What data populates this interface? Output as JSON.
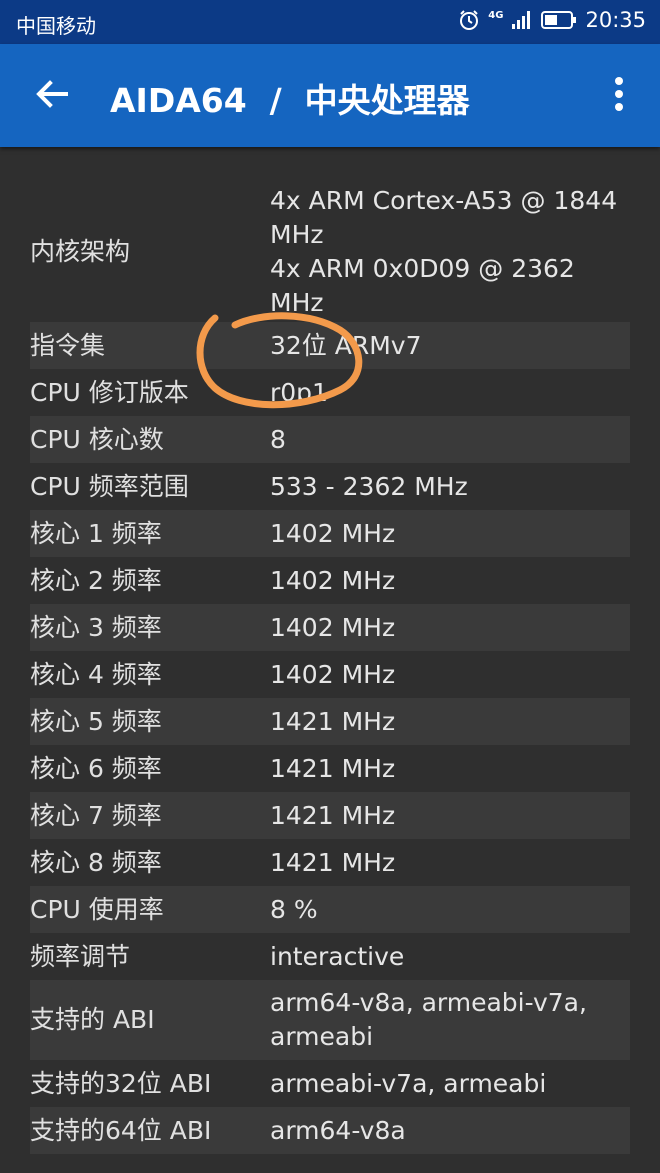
{
  "status": {
    "carrier": "中国移动",
    "network": "4G",
    "time": "20:35"
  },
  "appbar": {
    "title": "AIDA64  /  中央处理器"
  },
  "rows": [
    {
      "label": "内核架构",
      "value": "4x ARM Cortex-A53 @ 1844 MHz\n4x ARM 0x0D09 @ 2362 MHz"
    },
    {
      "label": "指令集",
      "value": "32位 ARMv7"
    },
    {
      "label": "CPU 修订版本",
      "value": "r0p1"
    },
    {
      "label": "CPU 核心数",
      "value": "8"
    },
    {
      "label": "CPU 频率范围",
      "value": "533 - 2362 MHz"
    },
    {
      "label": "核心 1 频率",
      "value": "1402 MHz"
    },
    {
      "label": "核心 2 频率",
      "value": "1402 MHz"
    },
    {
      "label": "核心 3 频率",
      "value": "1402 MHz"
    },
    {
      "label": "核心 4 频率",
      "value": "1402 MHz"
    },
    {
      "label": "核心 5 频率",
      "value": "1421 MHz"
    },
    {
      "label": "核心 6 频率",
      "value": "1421 MHz"
    },
    {
      "label": "核心 7 频率",
      "value": "1421 MHz"
    },
    {
      "label": "核心 8 频率",
      "value": "1421 MHz"
    },
    {
      "label": "CPU 使用率",
      "value": "8 %"
    },
    {
      "label": "频率调节",
      "value": "interactive"
    },
    {
      "label": "支持的 ABI",
      "value": "arm64-v8a, armeabi-v7a, armeabi"
    },
    {
      "label": "支持的32位 ABI",
      "value": "armeabi-v7a, armeabi"
    },
    {
      "label": "支持的64位 ABI",
      "value": "arm64-v8a"
    }
  ],
  "colors": {
    "appbar": "#1565c0",
    "statusbar": "#0c3a86",
    "background": "#2f2f2f",
    "row_alt": "#3a3a3a",
    "annotation": "#f39a4b"
  },
  "icons": {
    "back": "arrow-left-icon",
    "menu": "more-vert-icon",
    "alarm": "alarm-icon",
    "signal": "signal-icon",
    "battery": "battery-icon"
  }
}
